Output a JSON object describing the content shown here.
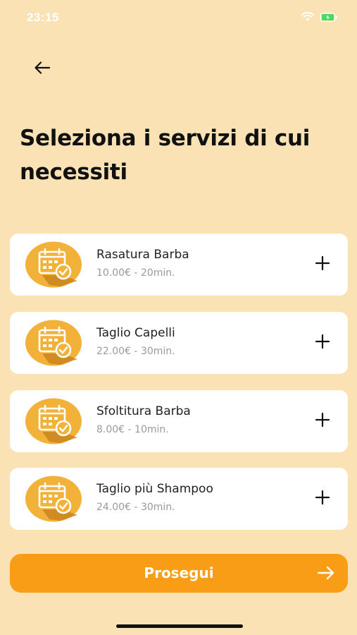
{
  "status_bar": {
    "time": "23:15",
    "icons": [
      "wifi-icon",
      "battery-charging-icon"
    ]
  },
  "header": {
    "back_icon": "arrow-left-icon"
  },
  "title": "Seleziona i servizi di cui necessiti",
  "services": [
    {
      "name": "Rasatura Barba",
      "meta": "10.00€ - 20min.",
      "icon": "calendar-check-icon"
    },
    {
      "name": "Taglio Capelli",
      "meta": "22.00€ - 30min.",
      "icon": "calendar-check-icon"
    },
    {
      "name": "Sfoltitura Barba",
      "meta": "8.00€ - 10min.",
      "icon": "calendar-check-icon"
    },
    {
      "name": "Taglio più Shampoo",
      "meta": "24.00€ - 30min.",
      "icon": "calendar-check-icon"
    }
  ],
  "footer": {
    "continue_label": "Prosegui",
    "continue_icon": "arrow-right-icon"
  },
  "colors": {
    "background": "#fae2b4",
    "accent": "#f99d16",
    "icon_circle": "#f2b23a",
    "card": "#ffffff"
  }
}
